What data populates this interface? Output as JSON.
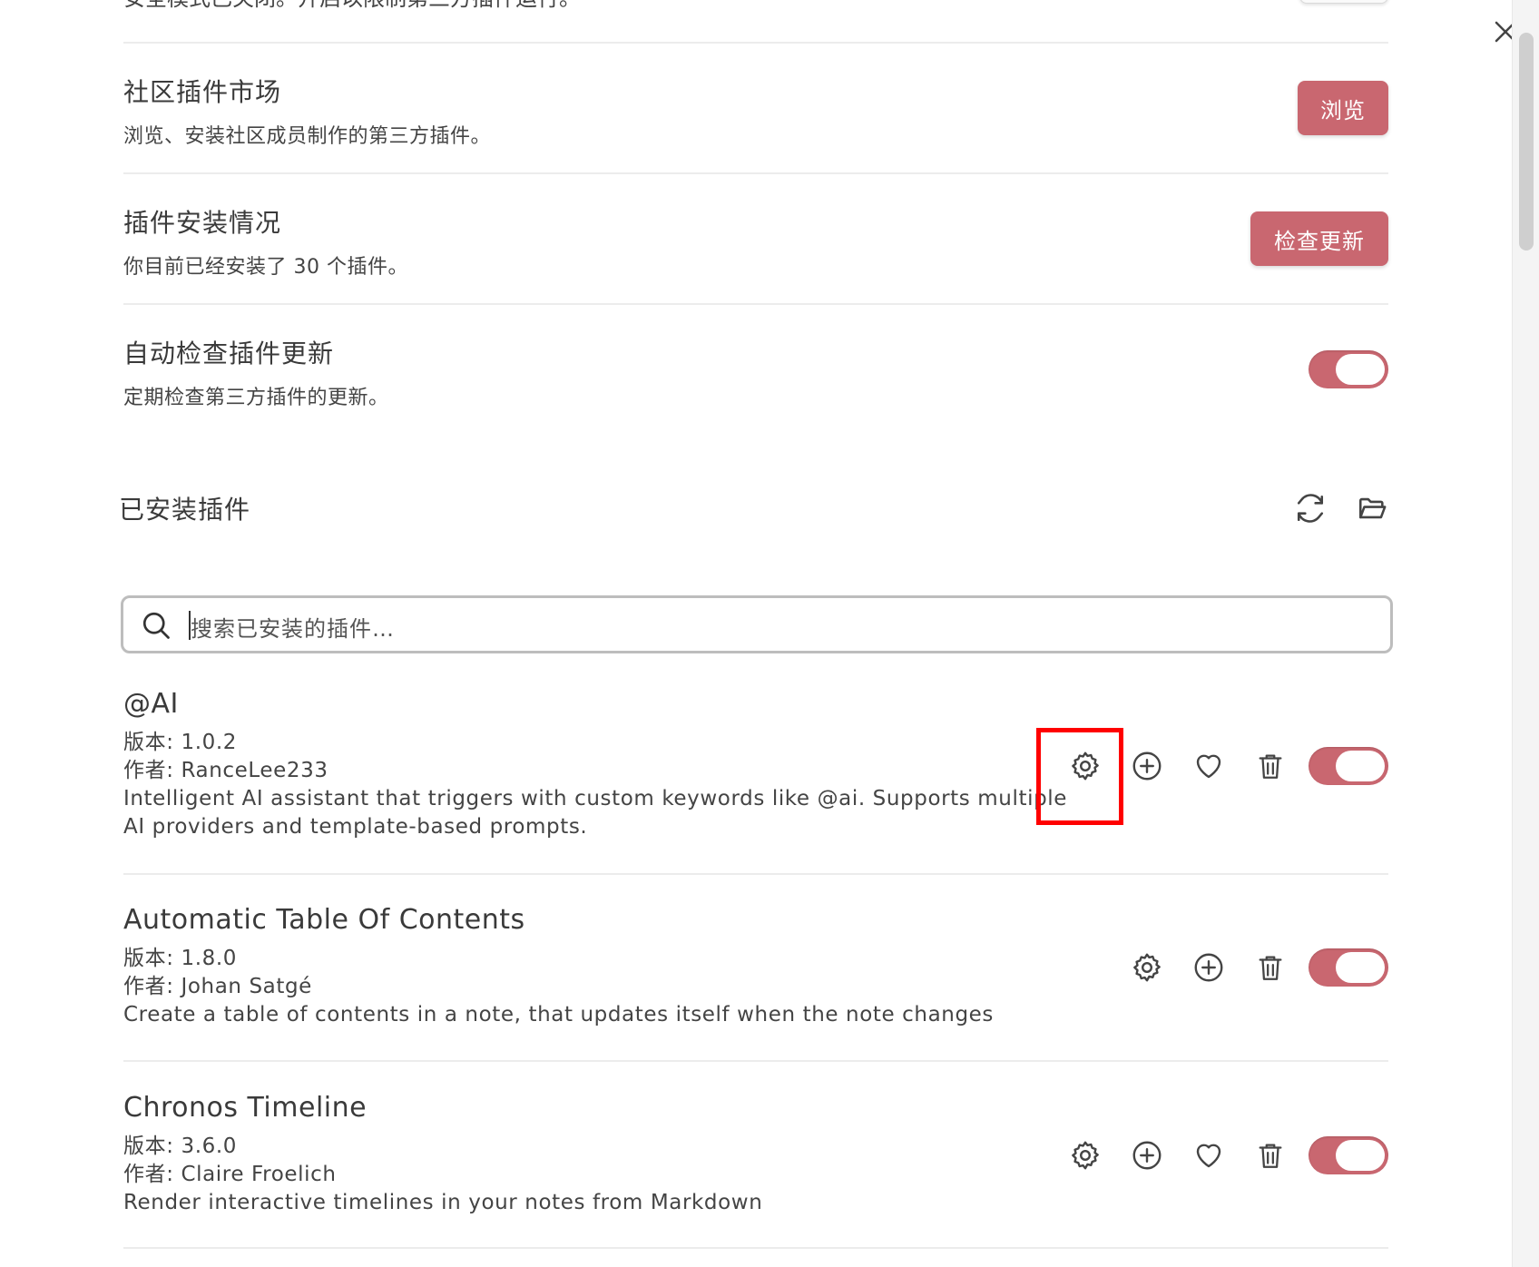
{
  "top_cutoff": {
    "text": "安全模式已关闭。开启以限制第三方插件运行。"
  },
  "settings": [
    {
      "name": "社区插件市场",
      "desc": "浏览、安装社区成员制作的第三方插件。",
      "button": "浏览"
    },
    {
      "name": "插件安装情况",
      "desc": "你目前已经安装了 30 个插件。",
      "button": "检查更新"
    },
    {
      "name": "自动检查插件更新",
      "desc": "定期检查第三方插件的更新。",
      "toggle": "on"
    }
  ],
  "installed": {
    "heading": "已安装插件",
    "search_placeholder": "搜索已安装的插件…"
  },
  "plugins": [
    {
      "name": "@AI",
      "version": "版本: 1.0.2",
      "author": "作者: RanceLee233",
      "desc_line1": "Intelligent AI assistant that triggers with custom keywords like @ai. Supports multiple",
      "desc_line2": "AI providers and template-based prompts.",
      "enabled": true
    },
    {
      "name": "Automatic Table Of Contents",
      "version": "版本: 1.8.0",
      "author": "作者: Johan Satgé",
      "desc_line1": "Create a table of contents in a note, that updates itself when the note changes",
      "enabled": true
    },
    {
      "name": "Chronos Timeline",
      "version": "版本: 3.6.0",
      "author": "作者: Claire Froelich",
      "desc_line1": "Render interactive timelines in your notes from Markdown",
      "enabled": true
    }
  ],
  "colors": {
    "accent": "#c96770",
    "highlight": "#ff0000"
  },
  "icons": [
    "close-icon",
    "reload-icon",
    "folder-open-icon",
    "search-icon",
    "gear-icon",
    "plus-circle-icon",
    "heart-icon",
    "trash-icon"
  ]
}
